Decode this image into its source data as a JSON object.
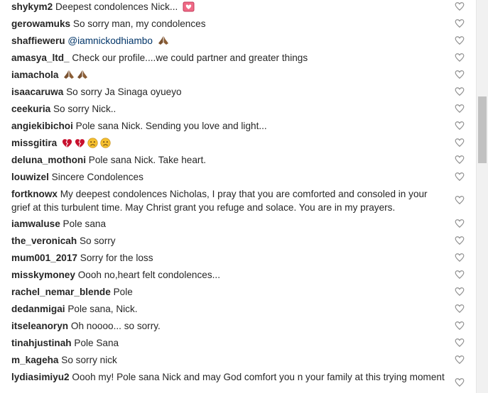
{
  "comments": [
    {
      "user": "shykym2",
      "text": "Deepest condolences Nick...",
      "emojis": [
        "love-letter"
      ]
    },
    {
      "user": "gerowamuks",
      "text": "So sorry man, my condolences",
      "emojis": []
    },
    {
      "user": "shaffieweru",
      "text": "",
      "mention": "@iamnickodhiambo",
      "emojis": [
        "folded-hands"
      ]
    },
    {
      "user": "amasya_ltd_",
      "text": "Check our profile....we could partner and greater things",
      "emojis": []
    },
    {
      "user": "iamachola",
      "text": "",
      "emojis": [
        "folded-hands",
        "folded-hands"
      ]
    },
    {
      "user": "isaacaruwa",
      "text": "So sorry Ja Sinaga oyueyo",
      "emojis": []
    },
    {
      "user": "ceekuria",
      "text": "So sorry Nick..",
      "emojis": []
    },
    {
      "user": "angiekibichoi",
      "text": "Pole sana Nick. Sending you love and light...",
      "emojis": []
    },
    {
      "user": "missgitira",
      "text": "",
      "emojis": [
        "broken-heart",
        "broken-heart",
        "sad-face",
        "sad-face"
      ]
    },
    {
      "user": "deluna_mothoni",
      "text": "Pole sana Nick. Take heart.",
      "emojis": []
    },
    {
      "user": "louwizel",
      "text": "Sincere Condolences",
      "emojis": []
    },
    {
      "user": "fortknowx",
      "text": "My deepest condolences Nicholas, I pray that you are comforted and consoled in your grief at this turbulent time. May Christ grant you refuge and solace. You are in my prayers.",
      "emojis": []
    },
    {
      "user": "iamwaluse",
      "text": "Pole sana",
      "emojis": []
    },
    {
      "user": "the_veronicah",
      "text": "So sorry",
      "emojis": []
    },
    {
      "user": "mum001_2017",
      "text": "Sorry for the loss",
      "emojis": []
    },
    {
      "user": "misskymoney",
      "text": "Oooh no,heart felt condolences...",
      "emojis": []
    },
    {
      "user": "rachel_nemar_blende",
      "text": "Pole",
      "emojis": []
    },
    {
      "user": "dedanmigai",
      "text": "Pole sana, Nick.",
      "emojis": []
    },
    {
      "user": "itseleanoryn",
      "text": "Oh noooo... so sorry.",
      "emojis": []
    },
    {
      "user": "tinahjustinah",
      "text": "Pole Sana",
      "emojis": []
    },
    {
      "user": "m_kageha",
      "text": "So sorry nick",
      "emojis": []
    },
    {
      "user": "lydiasimiyu2",
      "text": "Oooh my! Pole sana Nick and may God comfort you n your family at this trying moment",
      "emojis": []
    }
  ],
  "icons": {
    "like": "heart-outline-icon"
  },
  "colors": {
    "text": "#262626",
    "mention": "#003569",
    "heart_outline": "#8e8e8e",
    "scroll_track": "#f1f1f1",
    "scroll_thumb": "#c1c1c1"
  }
}
